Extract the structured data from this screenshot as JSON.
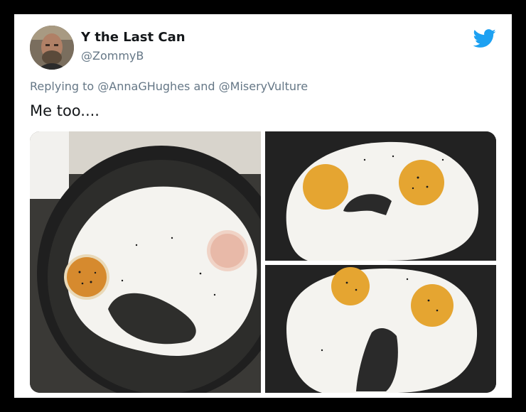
{
  "tweet": {
    "display_name": "Y the Last Can",
    "handle": "@ZommyB",
    "reply_prefix": "Replying to",
    "reply_mention_1": "@AnnaGHughes",
    "reply_and": "and",
    "reply_mention_2": "@MiseryVulture",
    "text": "Me too....",
    "brand_color": "#1da1f2"
  },
  "media": {
    "photos": [
      {
        "subject": "fried-egg-face-pan-1"
      },
      {
        "subject": "fried-egg-face-pan-2"
      },
      {
        "subject": "fried-egg-face-pan-3"
      }
    ]
  },
  "icons": {
    "brand": "twitter-bird-icon",
    "avatar": "avatar"
  }
}
